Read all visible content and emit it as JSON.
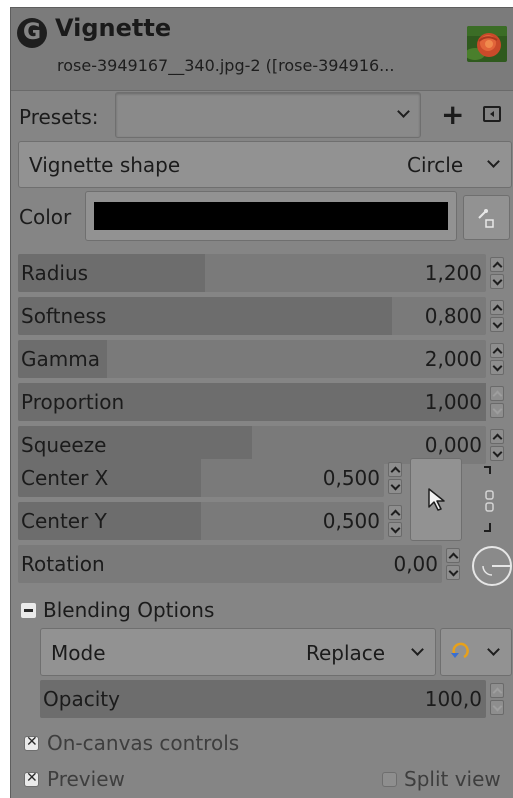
{
  "header": {
    "title": "Vignette",
    "subtitle": "rose-3949167__340.jpg-2 ([rose-394916..."
  },
  "presets": {
    "label": "Presets:",
    "value": "",
    "add_glyph": "+",
    "icons": [
      "chevron-down-icon",
      "plus-icon",
      "menu-icon"
    ]
  },
  "shape": {
    "label": "Vignette shape",
    "value": "Circle"
  },
  "color": {
    "label": "Color",
    "value": "#000000",
    "picker_icon": "color-picker-icon"
  },
  "params": [
    {
      "name": "Radius",
      "value": "1,200",
      "fill": 0.4
    },
    {
      "name": "Softness",
      "value": "0,800",
      "fill": 0.8
    },
    {
      "name": "Gamma",
      "value": "2,000",
      "fill": 0.19
    },
    {
      "name": "Proportion",
      "value": "1,000",
      "fill": 1.0
    },
    {
      "name": "Squeeze",
      "value": "0,000",
      "fill": 0.5
    }
  ],
  "center": {
    "x_label": "Center X",
    "x_value": "0,500",
    "y_label": "Center Y",
    "y_value": "0,500",
    "pick_icon": "pointer-arrow-icon",
    "chain_icon": "chain-link-icon"
  },
  "rotation": {
    "label": "Rotation",
    "value": "0,00",
    "dial_icon": "rotation-dial-icon"
  },
  "blending": {
    "label": "Blending Options",
    "mode_label": "Mode",
    "mode_value": "Replace",
    "opacity_label": "Opacity",
    "opacity_value": "100,0"
  },
  "toggles": {
    "on_canvas": "On-canvas controls",
    "preview": "Preview",
    "split_view": "Split view"
  }
}
